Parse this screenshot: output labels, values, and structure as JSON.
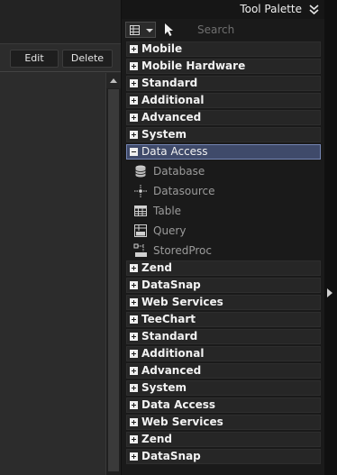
{
  "toolbar": {
    "edit_label": "Edit",
    "delete_label": "Delete"
  },
  "palette": {
    "title": "Tool Palette",
    "search_placeholder": "Search",
    "categories_before": [
      {
        "label": "Mobile"
      },
      {
        "label": "Mobile Hardware"
      },
      {
        "label": "Standard"
      },
      {
        "label": "Additional"
      },
      {
        "label": "Advanced"
      },
      {
        "label": "System"
      }
    ],
    "expanded_category": {
      "label": "Data Access",
      "components": [
        {
          "label": "Database",
          "icon": "database-icon"
        },
        {
          "label": "Datasource",
          "icon": "datasource-icon"
        },
        {
          "label": "Table",
          "icon": "table-icon"
        },
        {
          "label": "Query",
          "icon": "query-icon"
        },
        {
          "label": "StoredProc",
          "icon": "storedproc-icon"
        }
      ]
    },
    "categories_after": [
      {
        "label": "Zend"
      },
      {
        "label": "DataSnap"
      },
      {
        "label": "Web Services"
      },
      {
        "label": "TeeChart"
      },
      {
        "label": "Standard"
      },
      {
        "label": "Additional"
      },
      {
        "label": "Advanced"
      },
      {
        "label": "System"
      },
      {
        "label": "Data Access"
      },
      {
        "label": "Web Services"
      },
      {
        "label": "Zend"
      },
      {
        "label": "DataSnap"
      }
    ]
  }
}
